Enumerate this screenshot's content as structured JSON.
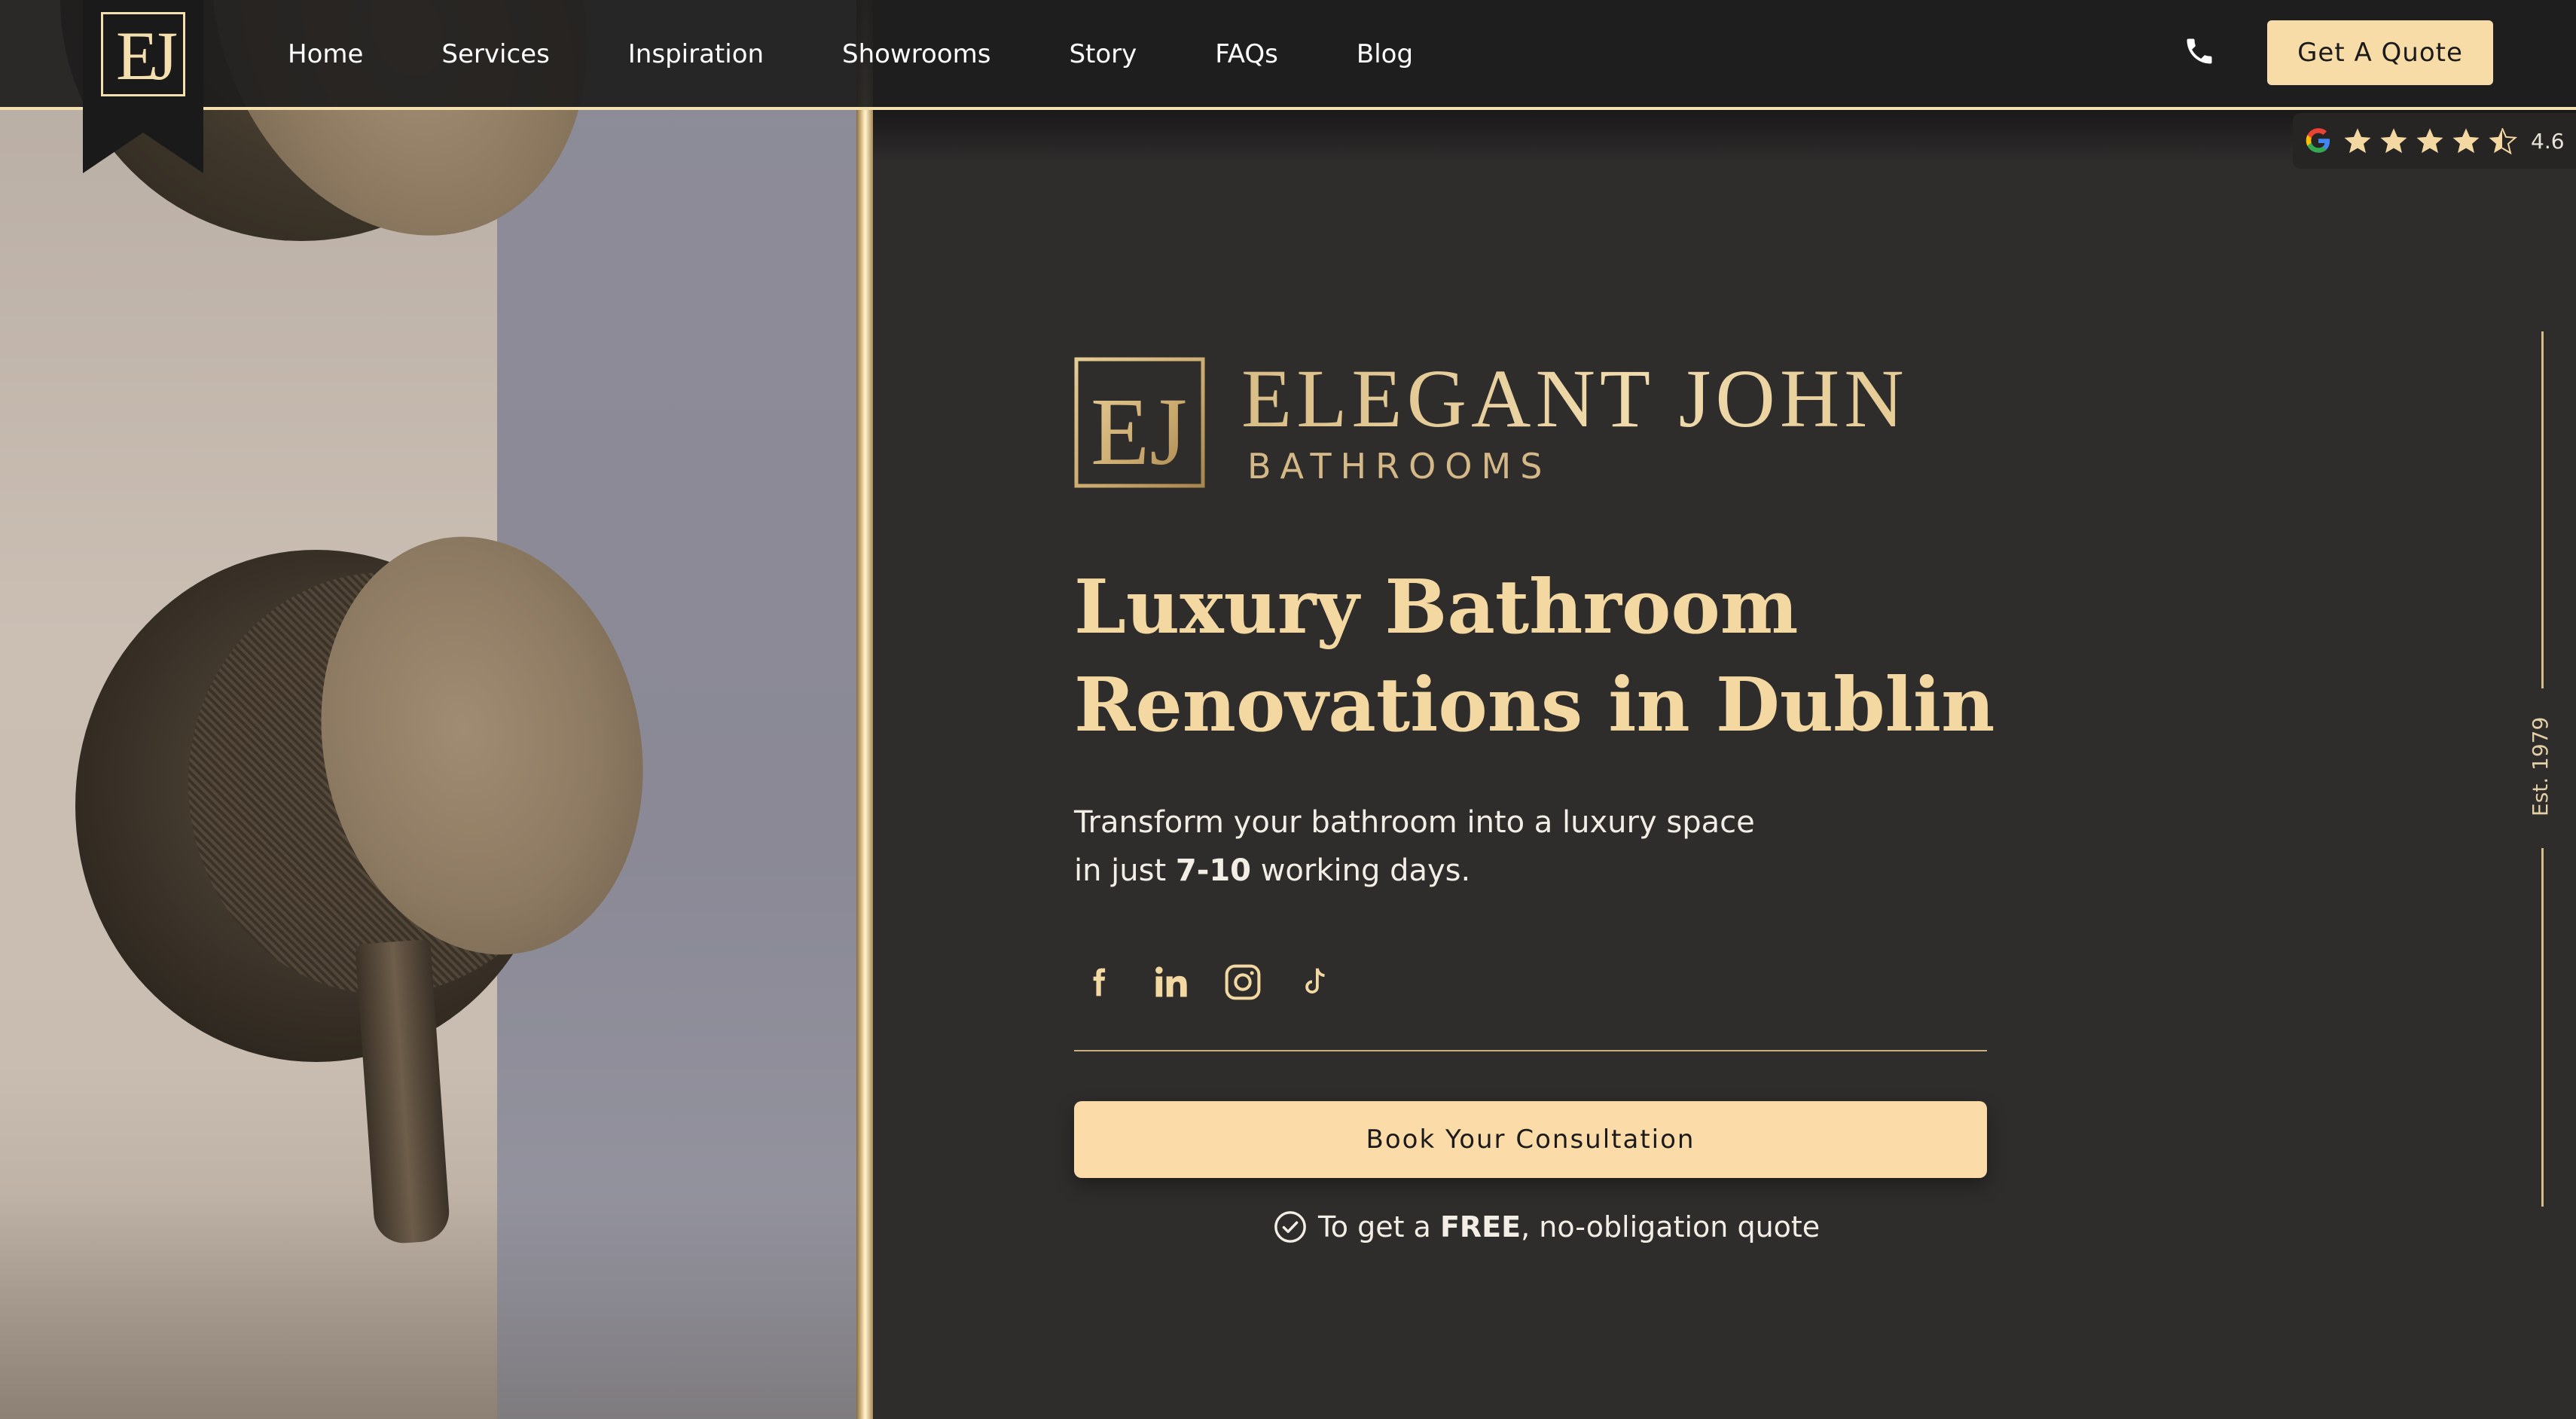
{
  "header": {
    "logo_initials": "EJ",
    "nav": [
      "Home",
      "Services",
      "Inspiration",
      "Showrooms",
      "Story",
      "FAQs",
      "Blog"
    ],
    "phone_icon": "phone-icon",
    "quote_label": "Get A Quote"
  },
  "rating": {
    "provider_icon": "google-icon",
    "stars": 4.5,
    "score": "4.6"
  },
  "hero": {
    "brand_initials": "EJ",
    "brand_name": "ELEGANT JOHN",
    "brand_sub": "BATHROOMS",
    "headline_line1": "Luxury Bathroom",
    "headline_line2": "Renovations in Dublin",
    "sub_line1": "Transform your bathroom into a luxury space",
    "sub_line2_prefix": "in just ",
    "sub_line2_bold": "7-10",
    "sub_line2_suffix": " working days.",
    "socials": [
      "facebook-icon",
      "linkedin-icon",
      "instagram-icon",
      "tiktok-icon"
    ],
    "cta_label": "Book Your Consultation",
    "note_prefix": "To get a ",
    "note_bold": "FREE",
    "note_suffix": ", no-obligation quote",
    "est": "Est. 1979"
  },
  "colors": {
    "accent": "#f7dca8",
    "gold": "#f3d8a2",
    "background": "#2f2d2c",
    "header": "#1e1d1d"
  }
}
